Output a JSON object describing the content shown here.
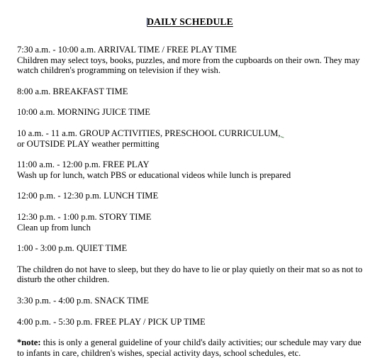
{
  "document": {
    "title": "DAILY SCHEDULE",
    "page_background": "#ffffff",
    "text_color": "#000000",
    "caret_color": "#2b3f8c",
    "spellcheck_mark_color": "#2f7a2f",
    "entries": [
      {
        "heading": "7:30 a.m. - 10:00 a.m.  ARRIVAL TIME / FREE PLAY TIME",
        "body": "Children may select toys, books, puzzles, and more from the cupboards on their own. They may watch children's programming on television if they wish."
      },
      {
        "heading": "8:00 a.m.  BREAKFAST TIME",
        "body": ""
      },
      {
        "heading": "10:00 a.m.  MORNING JUICE TIME",
        "body": ""
      },
      {
        "heading": "10 a.m. - 11 a.m.  GROUP ACTIVITIES, PRESCHOOL CURRICULUM,",
        "body": "or OUTSIDE PLAY weather permitting"
      },
      {
        "heading": "11:00 a.m. - 12:00 p.m.  FREE PLAY",
        "body": "Wash up for lunch, watch PBS or educational videos while lunch is prepared"
      },
      {
        "heading": "12:00 p.m. - 12:30 p.m.  LUNCH TIME",
        "body": ""
      },
      {
        "heading": "12:30 p.m. - 1:00 p.m.  STORY TIME",
        "body": "Clean up from lunch"
      },
      {
        "heading": "1:00 - 3:00 p.m.  QUIET TIME",
        "body": ""
      },
      {
        "heading": "",
        "body": "The children do not have to sleep, but they do have to lie or play quietly on their mat so as not to disturb the other children."
      },
      {
        "heading": "3:30 p.m. - 4:00 p.m.  SNACK TIME",
        "body": ""
      },
      {
        "heading": "4:00 p.m. - 5:30 p.m.  FREE PLAY / PICK UP TIME",
        "body": ""
      }
    ],
    "note": {
      "label": "*note:",
      "text": " this is only a general guideline of your child's daily activities; our schedule may vary due to infants in care, children's wishes, special activity days, school schedules, etc."
    }
  }
}
